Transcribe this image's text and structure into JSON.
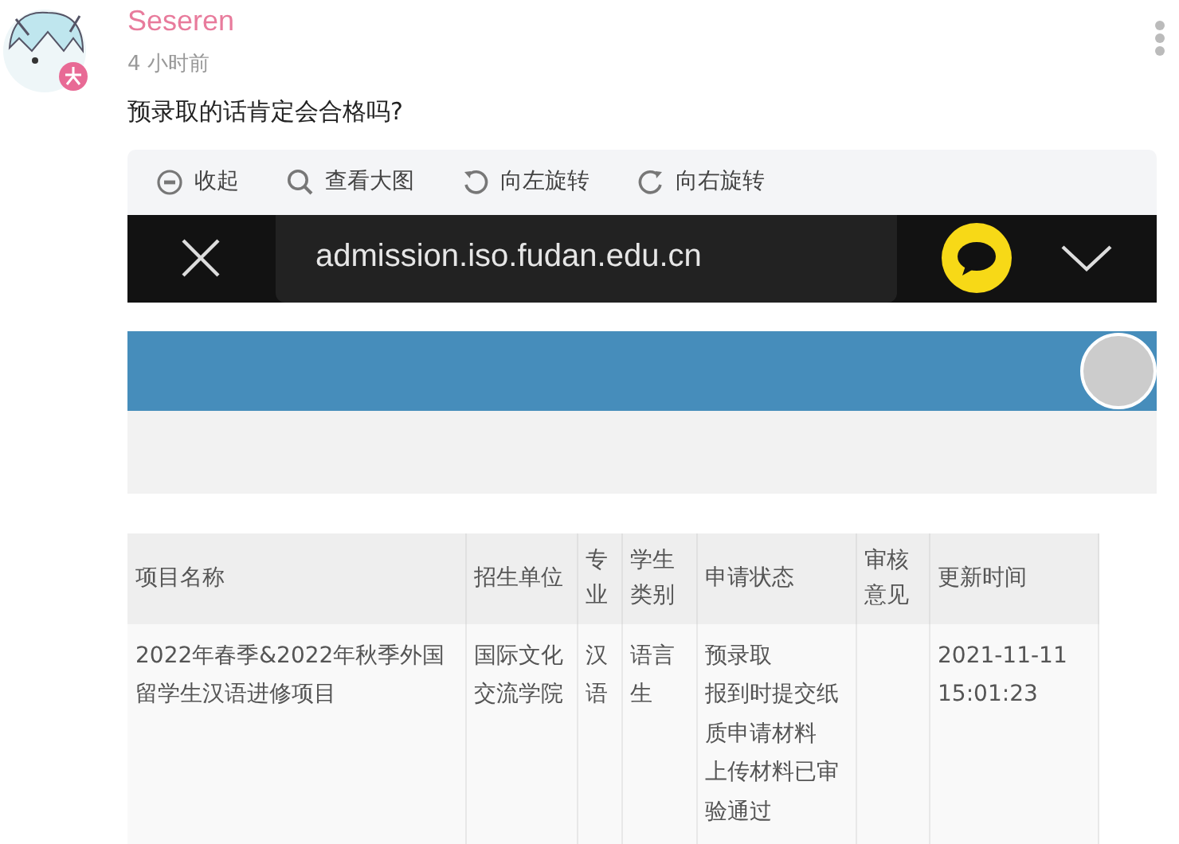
{
  "post": {
    "author": "Seseren",
    "time": "4 小时前",
    "text": "预录取的话肯定会合格吗?"
  },
  "toolbar": [
    {
      "kind": "collapse",
      "label": "收起"
    },
    {
      "kind": "zoom",
      "label": "查看大图"
    },
    {
      "kind": "rotate_left",
      "label": "向左旋转"
    },
    {
      "kind": "rotate_right",
      "label": "向右旋转"
    }
  ],
  "screenshot": {
    "url": "admission.iso.fudan.edu.cn",
    "table": {
      "columns": [
        "项目名称",
        "招生单位",
        "专业",
        "学生类别",
        "申请状态",
        "审核意见",
        "更新时间"
      ],
      "rows": [
        {
          "cells": [
            [
              "2022年春季&2022年秋季外国留学生汉语进修项目"
            ],
            [
              "国际文化交流学院"
            ],
            [
              "汉语"
            ],
            [
              "语言生"
            ],
            [
              "预录取",
              "报到时提交纸质申请材料",
              "上传材料已审验通过"
            ],
            [],
            [
              "2021-11-11 15:01:23"
            ]
          ]
        }
      ]
    }
  }
}
